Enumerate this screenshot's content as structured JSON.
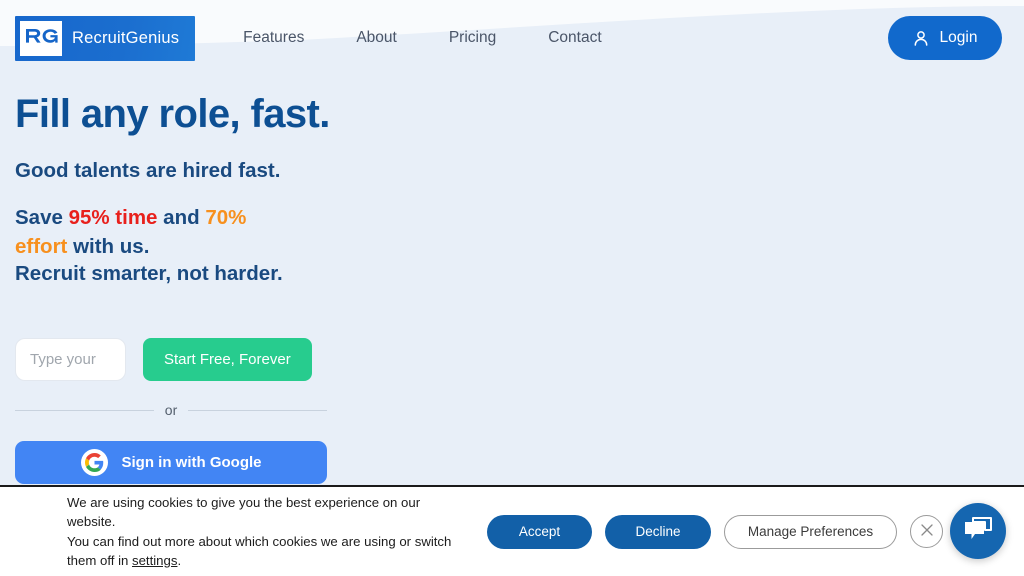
{
  "brand": {
    "logo_mark": "RG",
    "name": "RecruitGenius",
    "logo_icon": "rg-monogram-icon"
  },
  "nav": {
    "items": [
      {
        "label": "Features"
      },
      {
        "label": "About"
      },
      {
        "label": "Pricing"
      },
      {
        "label": "Contact"
      }
    ],
    "login": {
      "label": "Login",
      "icon": "user-icon",
      "color": "#1169cc"
    }
  },
  "hero": {
    "title": "Fill any role, fast.",
    "subtitle": "Good talents are hired fast.",
    "stats_prefix": "Save ",
    "stat_time": "95% time",
    "stats_middle": " and ",
    "stat_effort": "70% effort",
    "stats_suffix": " with us.",
    "tagline": "Recruit smarter, not harder.",
    "colors": {
      "title": "#0d4f93",
      "time": "#e8201c",
      "effort": "#f7901e",
      "background": "#e8eff8"
    }
  },
  "signup": {
    "email_placeholder": "Type your",
    "email_value": "",
    "cta_label": "Start Free, Forever",
    "cta_color": "#27cc8e",
    "divider_label": "or",
    "google_label": "Sign in with Google",
    "google_icon": "google-g-icon",
    "google_color": "#4285f4"
  },
  "cookie_banner": {
    "line1": "We are using cookies to give you the best experience on our website.",
    "line2_prefix": "You can find out more about which cookies we are using or switch them off in ",
    "settings_link": "settings",
    "line2_suffix": ".",
    "accept_label": "Accept",
    "decline_label": "Decline",
    "manage_label": "Manage Preferences",
    "close_icon": "close-icon",
    "button_color": "#1260a8"
  },
  "chat": {
    "icon": "chat-bubbles-icon",
    "color": "#1566b0"
  }
}
